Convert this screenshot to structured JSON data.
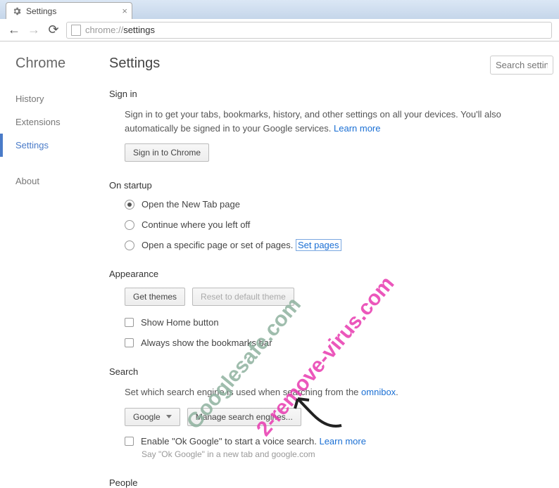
{
  "tab": {
    "title": "Settings"
  },
  "url": {
    "prefix": "chrome://",
    "path": "settings"
  },
  "sidebar": {
    "brand": "Chrome",
    "items": [
      "History",
      "Extensions",
      "Settings"
    ],
    "activeIndex": 2,
    "about": "About"
  },
  "page": {
    "title": "Settings",
    "search_placeholder": "Search setting"
  },
  "signin": {
    "heading": "Sign in",
    "desc_a": "Sign in to get your tabs, bookmarks, history, and other settings on all your devices. You'll also automatically be signed in to your Google services. ",
    "learn_more": "Learn more",
    "button": "Sign in to Chrome"
  },
  "startup": {
    "heading": "On startup",
    "opt1": "Open the New Tab page",
    "opt2": "Continue where you left off",
    "opt3": "Open a specific page or set of pages. ",
    "set_pages": "Set pages"
  },
  "appearance": {
    "heading": "Appearance",
    "get_themes": "Get themes",
    "reset_theme": "Reset to default theme",
    "show_home": "Show Home button",
    "always_bookmarks": "Always show the bookmarks bar"
  },
  "search": {
    "heading": "Search",
    "desc": "Set which search engine is used when searching from the ",
    "omnibox": "omnibox",
    "engine": "Google",
    "manage": "Manage search engines...",
    "ok_google": "Enable \"Ok Google\" to start a voice search. ",
    "learn_more": "Learn more",
    "hint": "Say \"Ok Google\" in a new tab and google.com"
  },
  "people": {
    "heading": "People"
  },
  "watermarks": {
    "a": "2-remove-virus.com",
    "b": "Googlesafe.com"
  }
}
